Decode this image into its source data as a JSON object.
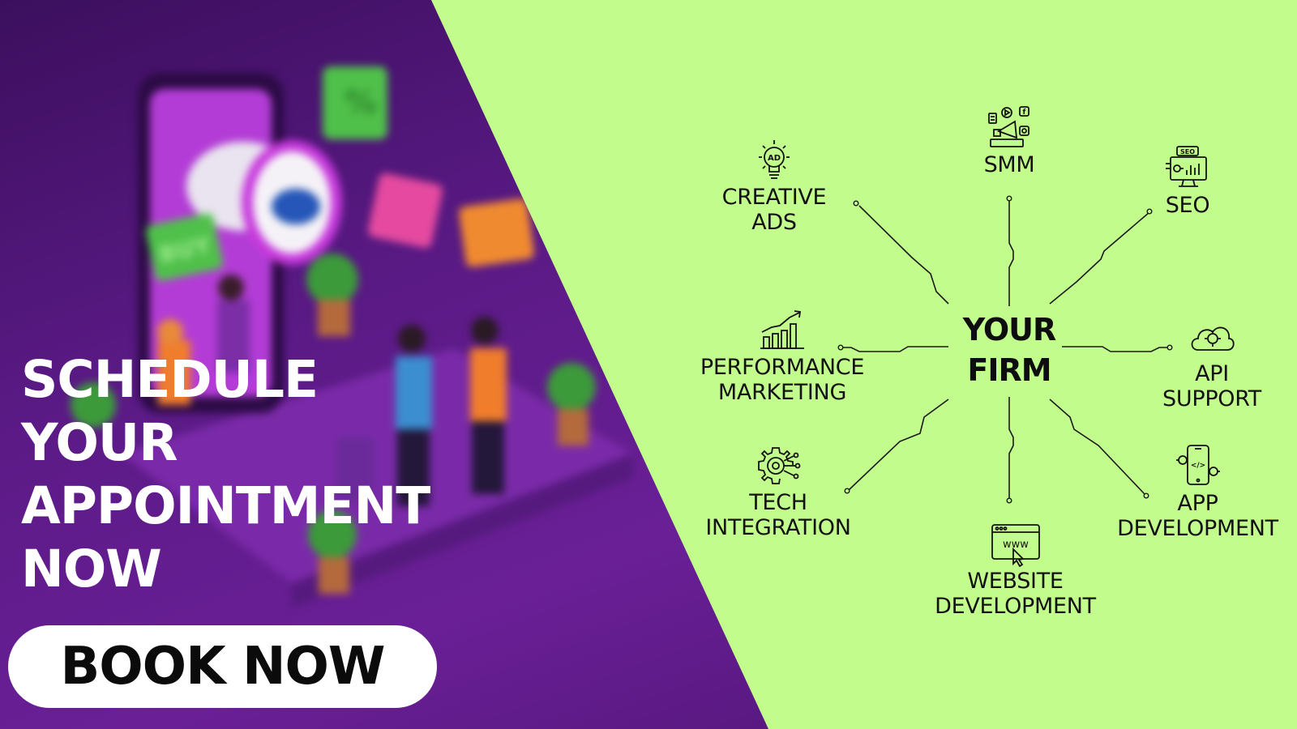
{
  "colors": {
    "background_green": "#c2fc8c",
    "purple_dark": "#3c0f5e",
    "purple_mid": "#6a1f96",
    "text_dark": "#121212",
    "button_bg": "#ffffff"
  },
  "promo": {
    "headline_lines": [
      "SCHEDULE",
      "YOUR",
      "APPOINTMENT",
      "NOW"
    ],
    "book_button_label": "BOOK NOW",
    "scene_signs": [
      "%",
      "BUY"
    ]
  },
  "diagram": {
    "center_lines": [
      "YOUR",
      "FIRM"
    ],
    "services": [
      {
        "id": "creative-ads",
        "icon": "lightbulb-ad-icon",
        "lines": [
          "CREATIVE",
          "ADS"
        ]
      },
      {
        "id": "smm",
        "icon": "megaphone-social-icon",
        "lines": [
          "SMM"
        ]
      },
      {
        "id": "seo",
        "icon": "seo-monitor-icon",
        "lines": [
          "SEO"
        ]
      },
      {
        "id": "performance-marketing",
        "icon": "bar-chart-growth-icon",
        "lines": [
          "PERFORMANCE",
          "MARKETING"
        ]
      },
      {
        "id": "api-support",
        "icon": "cloud-gear-icon",
        "lines": [
          "API",
          "SUPPORT"
        ]
      },
      {
        "id": "tech-integration",
        "icon": "gear-circuit-icon",
        "lines": [
          "TECH",
          "INTEGRATION"
        ]
      },
      {
        "id": "app-development",
        "icon": "mobile-code-icon",
        "lines": [
          "APP",
          "DEVELOPMENT"
        ]
      },
      {
        "id": "website-development",
        "icon": "browser-www-icon",
        "lines": [
          "WEBSITE",
          "DEVELOPMENT"
        ]
      }
    ],
    "icon_labels": {
      "creative_ad_badge": "AD",
      "seo_badge": "SEO",
      "website_www": "www",
      "smm_facebook": "f",
      "app_code": "</>"
    }
  }
}
